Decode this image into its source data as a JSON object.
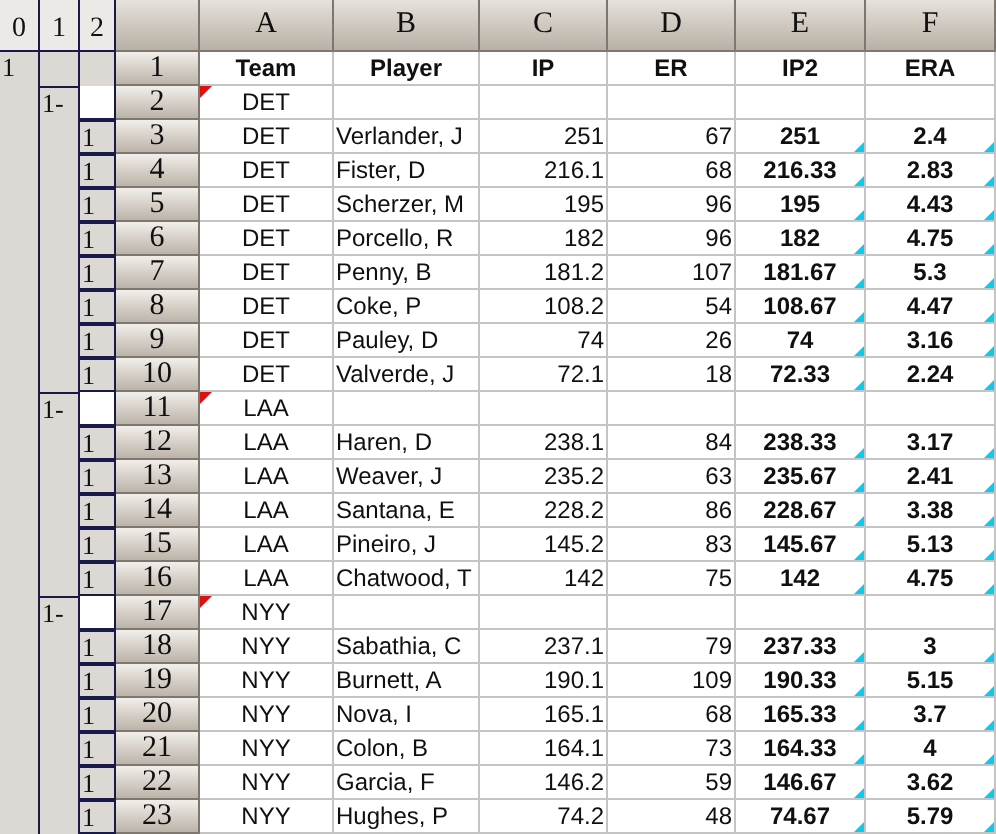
{
  "outline_levels": [
    "0",
    "1",
    "2"
  ],
  "columns": [
    "A",
    "B",
    "C",
    "D",
    "E",
    "F"
  ],
  "rows": [
    {
      "number": "1",
      "kind": "header",
      "outline": "1",
      "cells": [
        "Team",
        "Player",
        "IP",
        "ER",
        "IP2",
        "ERA"
      ]
    },
    {
      "number": "2",
      "kind": "group",
      "outline": "1-",
      "cells": [
        "DET"
      ]
    },
    {
      "number": "3",
      "kind": "data",
      "outline": "1",
      "cells": [
        "DET",
        "Verlander, J",
        "251",
        "67",
        "251",
        "2.4"
      ]
    },
    {
      "number": "4",
      "kind": "data",
      "outline": "1",
      "cells": [
        "DET",
        "Fister, D",
        "216.1",
        "68",
        "216.33",
        "2.83"
      ]
    },
    {
      "number": "5",
      "kind": "data",
      "outline": "1",
      "cells": [
        "DET",
        "Scherzer, M",
        "195",
        "96",
        "195",
        "4.43"
      ]
    },
    {
      "number": "6",
      "kind": "data",
      "outline": "1",
      "cells": [
        "DET",
        "Porcello, R",
        "182",
        "96",
        "182",
        "4.75"
      ]
    },
    {
      "number": "7",
      "kind": "data",
      "outline": "1",
      "cells": [
        "DET",
        "Penny, B",
        "181.2",
        "107",
        "181.67",
        "5.3"
      ]
    },
    {
      "number": "8",
      "kind": "data",
      "outline": "1",
      "cells": [
        "DET",
        "Coke, P",
        "108.2",
        "54",
        "108.67",
        "4.47"
      ]
    },
    {
      "number": "9",
      "kind": "data",
      "outline": "1",
      "cells": [
        "DET",
        "Pauley, D",
        "74",
        "26",
        "74",
        "3.16"
      ]
    },
    {
      "number": "10",
      "kind": "data",
      "outline": "1",
      "cells": [
        "DET",
        "Valverde, J",
        "72.1",
        "18",
        "72.33",
        "2.24"
      ]
    },
    {
      "number": "11",
      "kind": "group",
      "outline": "1-",
      "cells": [
        "LAA"
      ]
    },
    {
      "number": "12",
      "kind": "data",
      "outline": "1",
      "cells": [
        "LAA",
        "Haren, D",
        "238.1",
        "84",
        "238.33",
        "3.17"
      ]
    },
    {
      "number": "13",
      "kind": "data",
      "outline": "1",
      "cells": [
        "LAA",
        "Weaver, J",
        "235.2",
        "63",
        "235.67",
        "2.41"
      ]
    },
    {
      "number": "14",
      "kind": "data",
      "outline": "1",
      "cells": [
        "LAA",
        "Santana, E",
        "228.2",
        "86",
        "228.67",
        "3.38"
      ]
    },
    {
      "number": "15",
      "kind": "data",
      "outline": "1",
      "cells": [
        "LAA",
        "Pineiro, J",
        "145.2",
        "83",
        "145.67",
        "5.13"
      ]
    },
    {
      "number": "16",
      "kind": "data",
      "outline": "1",
      "cells": [
        "LAA",
        "Chatwood, T",
        "142",
        "75",
        "142",
        "4.75"
      ]
    },
    {
      "number": "17",
      "kind": "group",
      "outline": "1-",
      "cells": [
        "NYY"
      ]
    },
    {
      "number": "18",
      "kind": "data",
      "outline": "1",
      "cells": [
        "NYY",
        "Sabathia, C",
        "237.1",
        "79",
        "237.33",
        "3"
      ]
    },
    {
      "number": "19",
      "kind": "data",
      "outline": "1",
      "cells": [
        "NYY",
        "Burnett, A",
        "190.1",
        "109",
        "190.33",
        "5.15"
      ]
    },
    {
      "number": "20",
      "kind": "data",
      "outline": "1",
      "cells": [
        "NYY",
        "Nova, I",
        "165.1",
        "68",
        "165.33",
        "3.7"
      ]
    },
    {
      "number": "21",
      "kind": "data",
      "outline": "1",
      "cells": [
        "NYY",
        "Colon, B",
        "164.1",
        "73",
        "164.33",
        "4"
      ]
    },
    {
      "number": "22",
      "kind": "data",
      "outline": "1",
      "cells": [
        "NYY",
        "Garcia, F",
        "146.2",
        "59",
        "146.67",
        "3.62"
      ]
    },
    {
      "number": "23",
      "kind": "data",
      "outline": "1",
      "cells": [
        "NYY",
        "Hughes, P",
        "74.2",
        "48",
        "74.67",
        "5.79"
      ]
    }
  ]
}
